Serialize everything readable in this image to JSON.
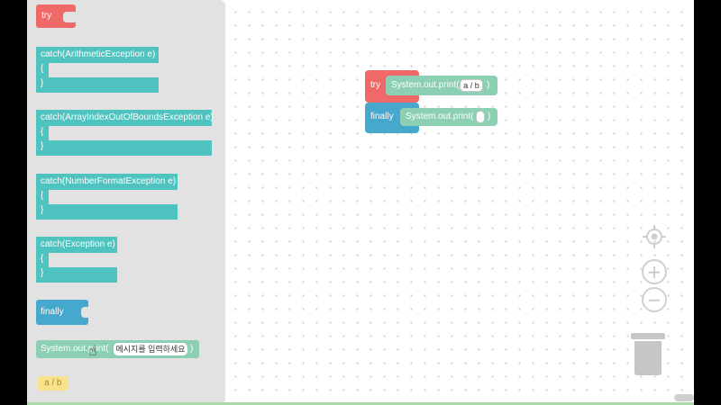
{
  "toolbox": {
    "try_label": "try",
    "catch_blocks": [
      {
        "header": "catch(ArithmeticException e)",
        "open": "{",
        "close": "}"
      },
      {
        "header": "catch(ArrayIndexOutOfBoundsException e)",
        "open": "{",
        "close": "}"
      },
      {
        "header": "catch(NumberFormatException e)",
        "open": "{",
        "close": "}"
      },
      {
        "header": "catch(Exception e)",
        "open": "{",
        "close": "}"
      }
    ],
    "finally_label": "finally",
    "print_label": "System.out.print(",
    "print_placeholder": "메시지를 입력하세요",
    "print_close": ")",
    "expr_label": "a / b"
  },
  "workspace": {
    "try_label": "try",
    "try_print_label": "System.out.print(",
    "try_print_arg": "a / b",
    "try_print_close": ")",
    "finally_label": "finally",
    "finally_print_label": "System.out.print(",
    "finally_print_arg": "",
    "finally_print_close": ")"
  },
  "controls": [
    "recenter-icon",
    "zoom-in-icon",
    "zoom-out-icon",
    "trash-icon"
  ],
  "colors": {
    "try": "#ef6968",
    "catch": "#4ec3bf",
    "finally": "#45a8cc",
    "print": "#8ccfb3",
    "expr": "#f8e28a"
  }
}
